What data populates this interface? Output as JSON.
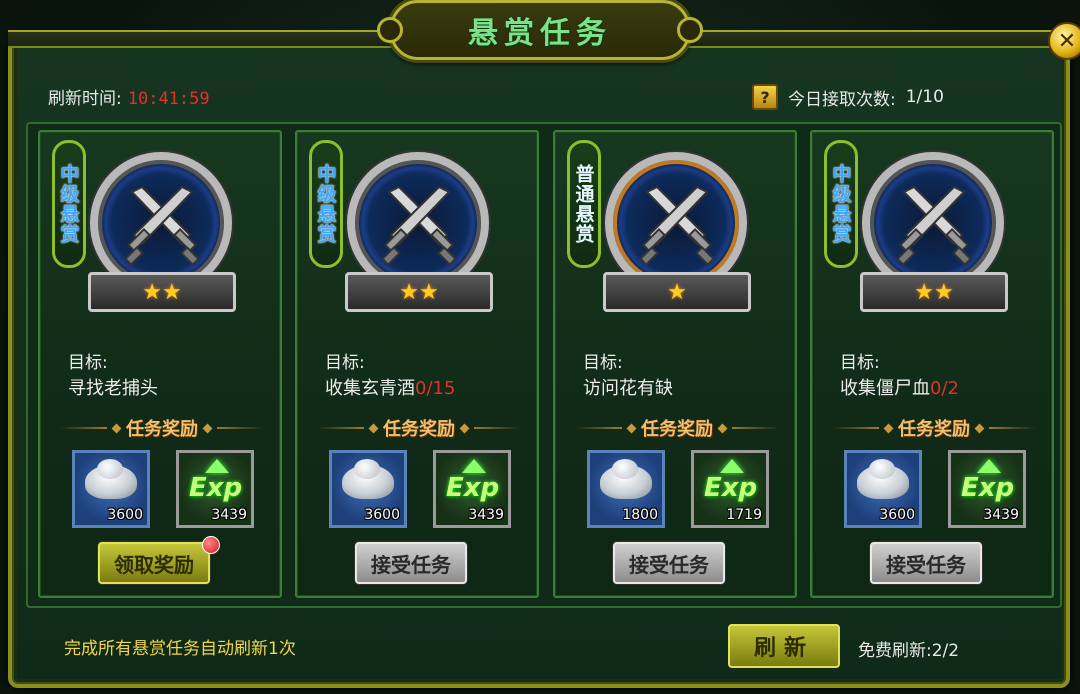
{
  "title": "悬赏任务",
  "header": {
    "refresh_label": "刷新时间:",
    "refresh_time": "10:41:59",
    "help_icon_char": "?",
    "daily_label": "今日接取次数:",
    "daily_count": "1/10"
  },
  "reward_title": "任务奖励",
  "goal_label": "目标:",
  "cards": [
    {
      "tag": "中级悬赏",
      "stars": "★★",
      "goal": "寻找老捕头",
      "progress": "",
      "silver_qty": "3600",
      "exp_qty": "3439",
      "button": "领取奖励"
    },
    {
      "tag": "中级悬赏",
      "stars": "★★",
      "goal": "收集玄青酒",
      "progress": "0/15",
      "silver_qty": "3600",
      "exp_qty": "3439",
      "button": "接受任务"
    },
    {
      "tag": "普通悬赏",
      "stars": "★",
      "goal": "访问花有缺",
      "progress": "",
      "silver_qty": "1800",
      "exp_qty": "1719",
      "button": "接受任务"
    },
    {
      "tag": "中级悬赏",
      "stars": "★★",
      "goal": "收集僵尸血",
      "progress": "0/2",
      "silver_qty": "3600",
      "exp_qty": "3439",
      "button": "接受任务"
    }
  ],
  "exp_text": "Exp",
  "footer": {
    "note": "完成所有悬赏任务自动刷新1次",
    "refresh_button": "刷新",
    "free_refresh": "免费刷新:2/2"
  },
  "close_icon_char": "✕"
}
